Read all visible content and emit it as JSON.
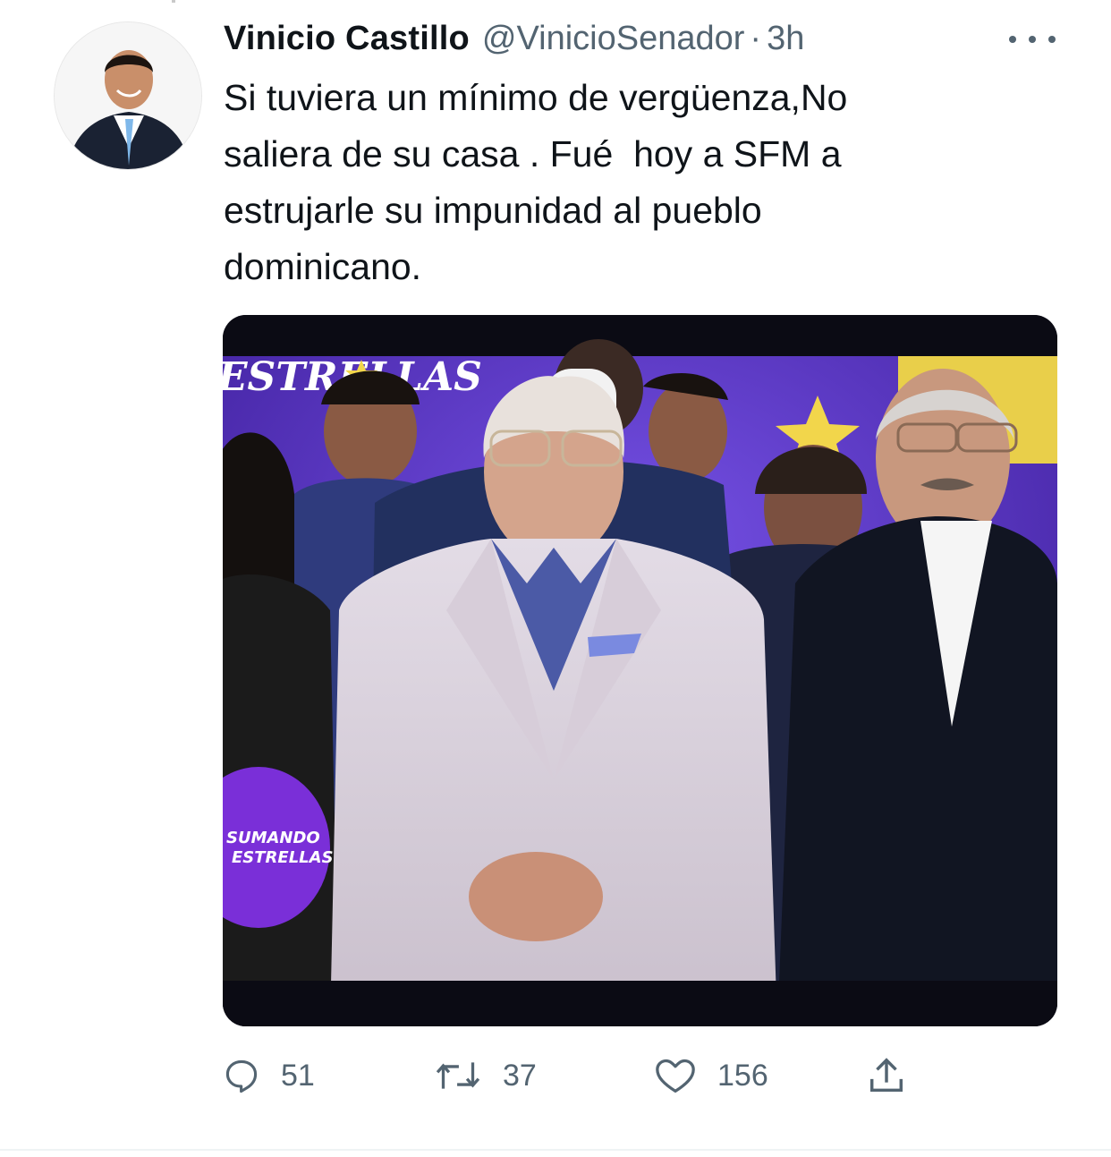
{
  "author": {
    "display_name": "Vinicio Castillo",
    "handle": "@VinicioSenador",
    "separator": "·",
    "time": "3h"
  },
  "tweet": {
    "text": "Si tuviera un mínimo de vergüenza,No\nsaliera de su casa . Fué  hoy a SFM a\nestrujarle su impunidad al pueblo\ndominicano."
  },
  "media": {
    "banner_text": "ESTRELLAS",
    "logo_text_1": "SUMANDO",
    "logo_text_2": "ESTRELLAS",
    "colors": {
      "backdrop": "#5b2fd6",
      "star": "#f2d64b",
      "letterbox": "#0b0b14"
    }
  },
  "actions": {
    "reply": {
      "icon": "reply-icon",
      "count": "51"
    },
    "retweet": {
      "icon": "retweet-icon",
      "count": "37"
    },
    "like": {
      "icon": "heart-icon",
      "count": "156"
    },
    "share": {
      "icon": "share-icon"
    }
  },
  "colors": {
    "text": "#0f1419",
    "muted": "#536471"
  }
}
